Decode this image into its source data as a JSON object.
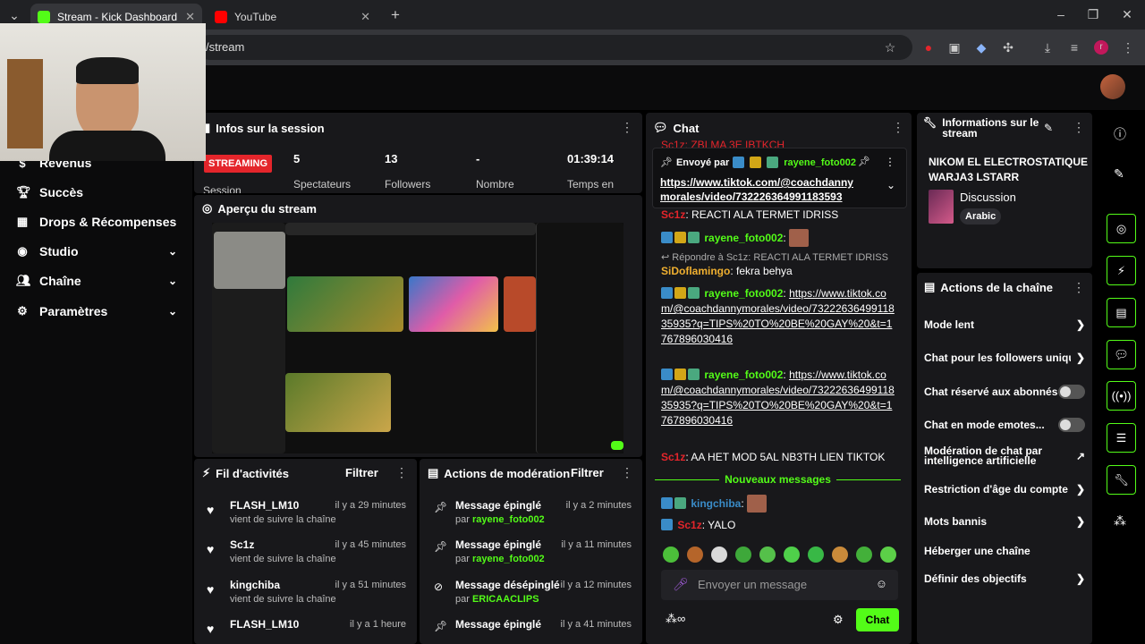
{
  "browser": {
    "tabs": [
      {
        "title": "Stream - Kick Dashboard",
        "active": true
      },
      {
        "title": "YouTube",
        "active": false
      }
    ],
    "url": "/stream"
  },
  "sidebar": {
    "items": [
      {
        "label": "Revenus",
        "icon": "dollar-icon",
        "expandable": false
      },
      {
        "label": "Succès",
        "icon": "trophy-icon",
        "expandable": false
      },
      {
        "label": "Drops & Récompenses",
        "icon": "gift-icon",
        "expandable": false
      },
      {
        "label": "Studio",
        "icon": "studio-icon",
        "expandable": true
      },
      {
        "label": "Chaîne",
        "icon": "users-icon",
        "expandable": true
      },
      {
        "label": "Paramètres",
        "icon": "gear-icon",
        "expandable": true
      }
    ]
  },
  "session": {
    "title": "Infos sur la session",
    "status": "STREAMING",
    "status_label": "Session",
    "stats": [
      {
        "value": "5",
        "label": "Spectateurs"
      },
      {
        "value": "13",
        "label": "Followers"
      },
      {
        "value": "-",
        "label": "Nombre"
      },
      {
        "value": "01:39:14",
        "label": "Temps en"
      }
    ]
  },
  "preview": {
    "title": "Aperçu du stream"
  },
  "activity": {
    "title": "Fil d'activités",
    "filter": "Filtrer",
    "items": [
      {
        "name": "FLASH_LM10",
        "time": "il y a 29 minutes",
        "desc": "vient de suivre la chaîne"
      },
      {
        "name": "Sc1z",
        "time": "il y a 45 minutes",
        "desc": "vient de suivre la chaîne"
      },
      {
        "name": "kingchiba",
        "time": "il y a 51 minutes",
        "desc": "vient de suivre la chaîne"
      },
      {
        "name": "FLASH_LM10",
        "time": "il y a 1 heure",
        "desc": ""
      }
    ]
  },
  "moderation": {
    "title": "Actions de modération",
    "filter": "Filtrer",
    "items": [
      {
        "action": "Message épinglé",
        "time": "il y a 2 minutes",
        "by": "par",
        "user": "rayene_foto002"
      },
      {
        "action": "Message épinglé",
        "time": "il y a 11 minutes",
        "by": "par",
        "user": "rayene_foto002"
      },
      {
        "action": "Message désépinglé",
        "time": "il y a 12 minutes",
        "by": "par",
        "user": "ERICAACLIPS"
      },
      {
        "action": "Message épinglé",
        "time": "il y a 41 minutes",
        "by": "",
        "user": ""
      }
    ]
  },
  "chat": {
    "title": "Chat",
    "top_partial": "Sc1z: ZBI MA 3E IBTKCH",
    "pinned": {
      "label": "Envoyé par",
      "user": "rayene_foto002",
      "link": "https://www.tiktok.com/@coachdannymorales/video/7322263649911835935?..."
    },
    "messages": [
      {
        "user": "Sc1z",
        "color": "#e4252b",
        "text": "REACTI ALA TERMET IDRISS",
        "badges": []
      },
      {
        "user": "rayene_foto002",
        "color": "#53fc18",
        "text": "",
        "badges": [
          "mod",
          "crown",
          "vip"
        ]
      },
      {
        "reply": "Répondre à Sc1z: REACTI ALA TERMET IDRISS"
      },
      {
        "user": "SiDoflamingo",
        "color": "#f0b030",
        "text": "fekra behya",
        "badges": []
      },
      {
        "user": "rayene_foto002",
        "color": "#53fc18",
        "text": "https://www.tiktok.com/@coachdannymorales/video/7322263649911835935?q=TIPS%20TO%20BE%20GAY%20&t=1767896030416",
        "badges": [
          "mod",
          "crown",
          "vip"
        ]
      },
      {
        "user": "rayene_foto002",
        "color": "#53fc18",
        "text": "https://www.tiktok.com/@coachdannymorales/video/7322263649911835935?q=TIPS%20TO%20BE%20GAY%20&t=1767896030416",
        "badges": [
          "mod",
          "crown",
          "vip"
        ]
      },
      {
        "user": "Sc1z",
        "color": "#e4252b",
        "text": "AA HET MOD 5AL NB3TH LIEN TIKTOK",
        "badges": []
      }
    ],
    "new_messages_label": "Nouveaux messages",
    "new": [
      {
        "user": "kingchiba",
        "color": "#3a8cc8",
        "text": "",
        "badges": [
          "mod",
          "vip"
        ]
      },
      {
        "user": "Sc1z",
        "color": "#e4252b",
        "text": "YALO",
        "badges": [
          "mod"
        ]
      }
    ],
    "input_placeholder": "Envoyer un message",
    "send_label": "Chat"
  },
  "stream_info": {
    "title": "Informations sur le stream",
    "stream_title": "NIKOM EL ELECTROSTATIQUE WARJA3 LSTARR",
    "category": "Discussion",
    "language": "Arabic"
  },
  "channel_actions": {
    "title": "Actions de la chaîne",
    "items": [
      {
        "label": "Mode lent",
        "kind": "chevron"
      },
      {
        "label": "Chat pour les followers uniqu",
        "kind": "chevron"
      },
      {
        "label": "Chat réservé aux abonnés",
        "kind": "toggle"
      },
      {
        "label": "Chat en mode emotes...",
        "kind": "toggle"
      },
      {
        "label": "Modération de chat par intelligence artificielle",
        "kind": "external"
      },
      {
        "label": "Restriction d'âge du compte",
        "kind": "chevron"
      },
      {
        "label": "Mots bannis",
        "kind": "chevron"
      },
      {
        "label": "Héberger une chaîne",
        "kind": "none"
      },
      {
        "label": "Définir des objectifs",
        "kind": "chevron"
      }
    ]
  },
  "colors": {
    "accent": "#53fc18",
    "live": "#e4252b",
    "panel": "#18181b"
  }
}
